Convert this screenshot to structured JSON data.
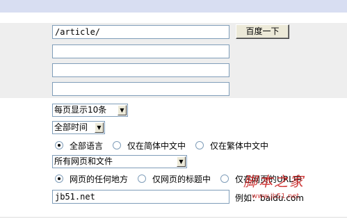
{
  "search": {
    "query_value": "/article/",
    "submit_label": "百度一下",
    "extra_fields": [
      "",
      "",
      ""
    ]
  },
  "options": {
    "results_per_page": "每页显示10条",
    "time_range": "全部时间",
    "language": [
      "全部语言",
      "仅在简体中文中",
      "仅在繁体中文中"
    ],
    "file_type": "所有网页和文件",
    "position": [
      "网页的任何地方",
      "仅网页的标题中",
      "仅在网页的URL中"
    ],
    "site_value": "jb51.net",
    "site_example": "例如：baidu.com"
  },
  "watermark": {
    "text": "脚本之家",
    "url": "www.jb51.net"
  }
}
